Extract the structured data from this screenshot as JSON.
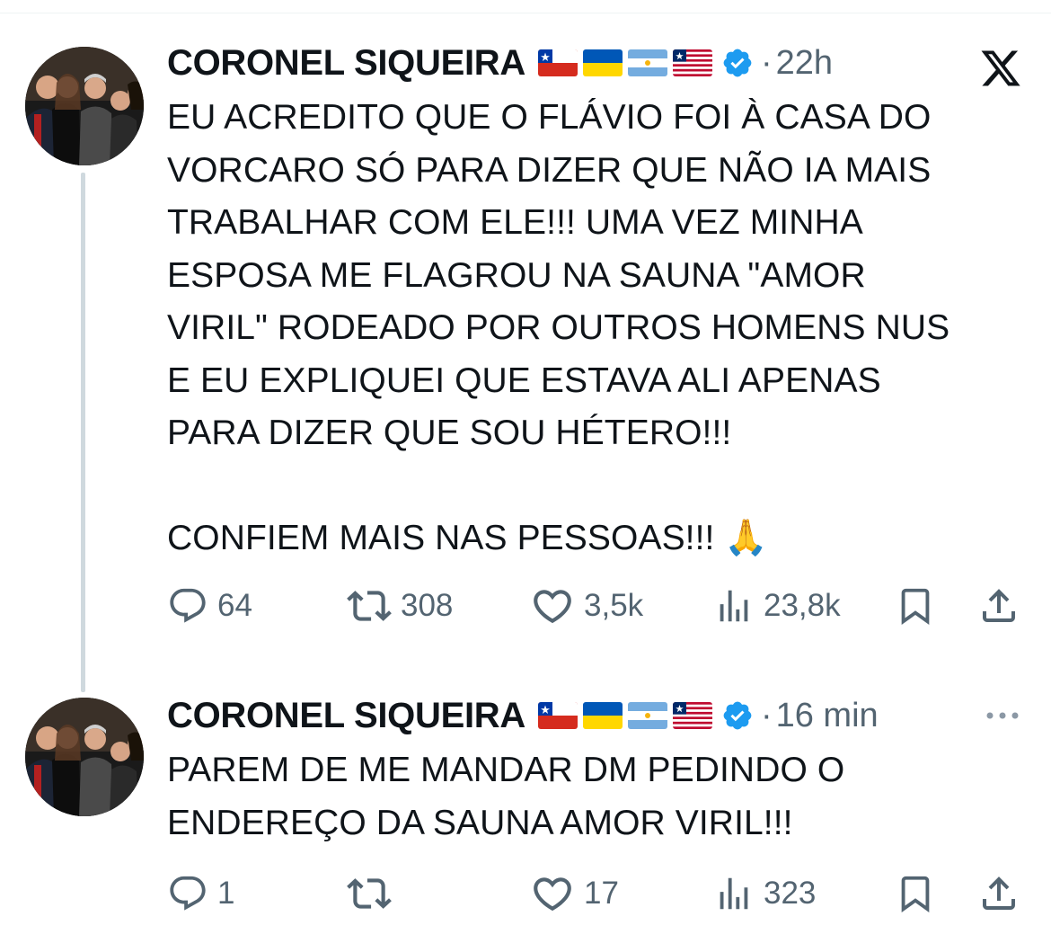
{
  "tweets": [
    {
      "author": "CORONEL SIQUEIRA",
      "time": "22h",
      "dot": "·",
      "text": "EU ACREDITO QUE O FLÁVIO FOI À CASA DO\nVORCARO SÓ PARA DIZER QUE NÃO IA MAIS\nTRABALHAR COM ELE!!! UMA VEZ MINHA\nESPOSA ME FLAGROU NA SAUNA \"AMOR\nVIRIL\" RODEADO POR OUTROS HOMENS NUS\nE EU EXPLIQUEI QUE ESTAVA ALI APENAS\nPARA DIZER QUE SOU HÉTERO!!!\n\nCONFIEM MAIS NAS PESSOAS!!! 🙏",
      "replies": "64",
      "reposts": "308",
      "likes": "3,5k",
      "views": "23,8k"
    },
    {
      "author": "CORONEL SIQUEIRA",
      "time": "16 min",
      "dot": "·",
      "text": "PAREM DE ME MANDAR DM PEDINDO O\nENDEREÇO DA SAUNA AMOR VIRIL!!!",
      "replies": "1",
      "reposts": "",
      "likes": "17",
      "views": "323"
    }
  ],
  "icons": {
    "flags": [
      "chile-flag-icon",
      "ukraine-flag-icon",
      "argentina-flag-icon",
      "liberia-flag-icon"
    ],
    "verified": "verified-badge-icon",
    "platform": "x-logo-icon",
    "more": "more-options-icon"
  },
  "colors": {
    "text": "#0f1419",
    "secondary": "#536471",
    "verified": "#1d9bf0",
    "thread_line": "#cfd9de"
  }
}
